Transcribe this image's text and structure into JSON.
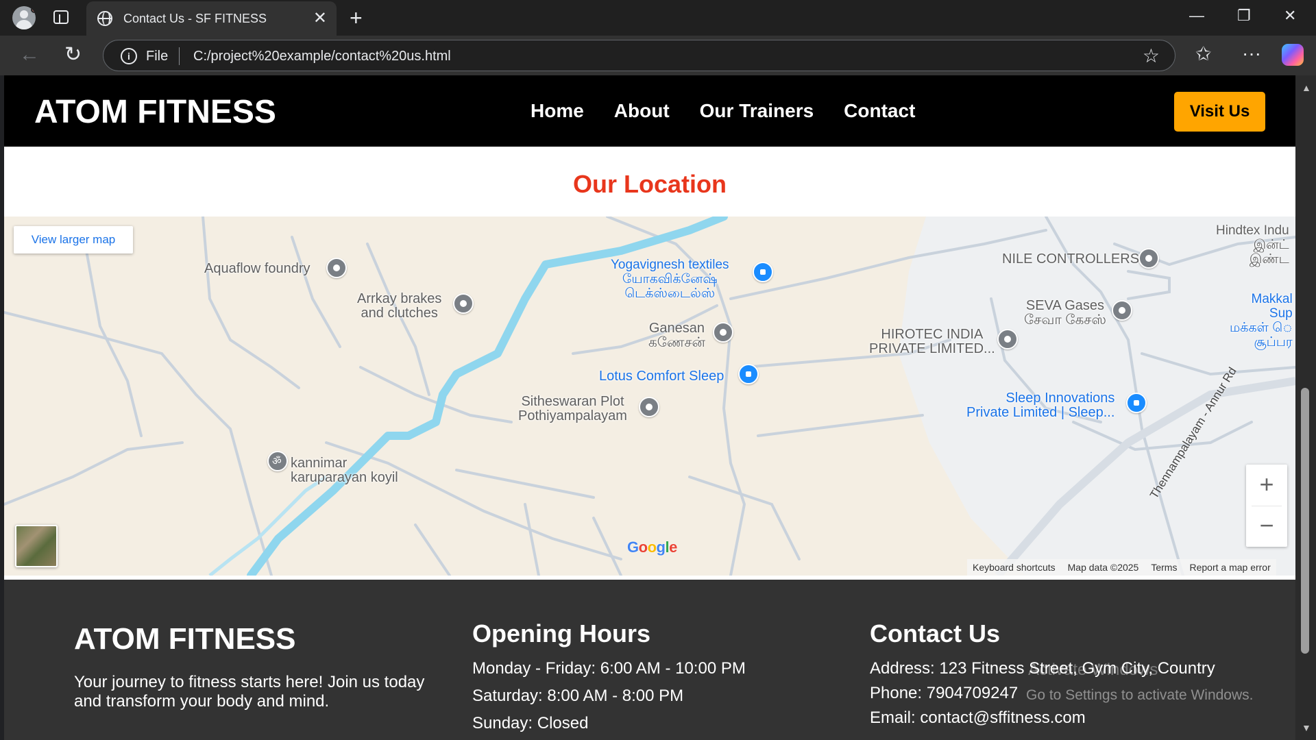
{
  "browser": {
    "tab_title": "Contact Us - SF FITNESS",
    "url_scheme": "File",
    "url": "C:/project%20example/contact%20us.html"
  },
  "site": {
    "logo": "ATOM FITNESS",
    "nav": [
      "Home",
      "About",
      "Our Trainers",
      "Contact"
    ],
    "visit_button": "Visit Us",
    "location_title": "Our Location"
  },
  "map": {
    "view_larger": "View larger map",
    "places": [
      {
        "name": "Aquaflow foundry",
        "type": "gray"
      },
      {
        "name": "Arrkay brakes\nand clutches",
        "type": "gray"
      },
      {
        "name": "Yogavignesh textiles\nயோகவிக்னேஷ்\nடெக்ஸ்டைல்ஸ்",
        "type": "blue"
      },
      {
        "name": "NILE CONTROLLERS",
        "type": "gray"
      },
      {
        "name": "Hindtex Indu\nஇன்ட்\nஇண்ட",
        "type": "gray"
      },
      {
        "name": "Ganesan\nகணேசன்",
        "type": "gray"
      },
      {
        "name": "SEVA Gases\nசேவா கேசஸ்",
        "type": "gray"
      },
      {
        "name": "Makkal\nSup\nமக்கள் ெ\nசூப்பர",
        "type": "blue"
      },
      {
        "name": "HIROTEC INDIA\nPRIVATE LIMITED...",
        "type": "gray"
      },
      {
        "name": "Lotus Comfort Sleep",
        "type": "blue"
      },
      {
        "name": "Sitheswaran Plot\nPothiyampalayam",
        "type": "gray"
      },
      {
        "name": "Sleep Innovations\nPrivate Limited | Sleep...",
        "type": "blue"
      },
      {
        "name": "kannimar\nkaruparayan koyil",
        "type": "temple"
      }
    ],
    "road_name": "Thennampalayam - Annur Rd",
    "zoom_in": "+",
    "zoom_out": "−",
    "attribution": [
      "Keyboard shortcuts",
      "Map data ©2025",
      "Terms",
      "Report a map error"
    ]
  },
  "footer": {
    "brand": "ATOM FITNESS",
    "tagline": "Your journey to fitness starts here! Join us today and transform your body and mind.",
    "hours_title": "Opening Hours",
    "hours": [
      "Monday - Friday: 6:00 AM - 10:00 PM",
      "Saturday: 8:00 AM - 8:00 PM",
      "Sunday: Closed"
    ],
    "contact_title": "Contact Us",
    "contact": [
      "Address: 123 Fitness Street, Gym City, Country",
      "Phone: 7904709247",
      "Email: contact@sffitness.com"
    ]
  },
  "os_watermark": {
    "line1": "Activate Windows",
    "line2": "Go to Settings to activate Windows."
  }
}
